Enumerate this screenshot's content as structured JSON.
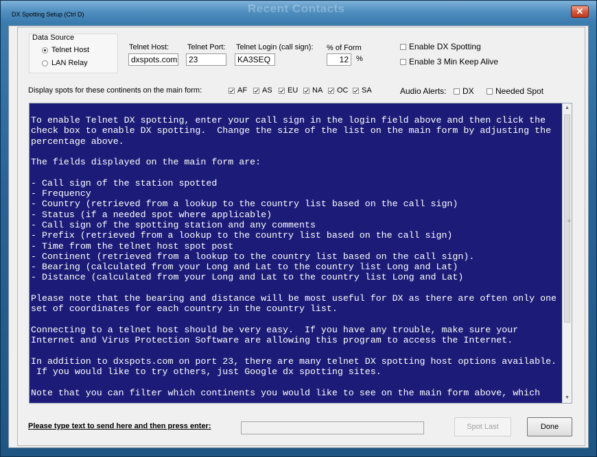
{
  "window": {
    "title": "DX Spotting Setup   (Ctrl D)",
    "background_title": "Recent Contacts",
    "close_glyph": "✕"
  },
  "data_source": {
    "title": "Data Source",
    "options": [
      {
        "label": "Telnet Host",
        "selected": true
      },
      {
        "label": "LAN Relay",
        "selected": false
      }
    ]
  },
  "telnet": {
    "host_label": "Telnet Host:",
    "host_value": "dxspots.com",
    "port_label": "Telnet Port:",
    "port_value": "23",
    "login_label": "Telnet Login (call sign):",
    "login_value": "KA3SEQ"
  },
  "form_percent": {
    "label": "% of Form",
    "value": "12",
    "unit": "%"
  },
  "options": {
    "enable_dx_spotting": {
      "label": "Enable DX Spotting",
      "checked": false
    },
    "keep_alive": {
      "label": "Enable 3 Min Keep Alive",
      "checked": false
    }
  },
  "continents": {
    "label": "Display spots for these continents on the main form:",
    "items": [
      {
        "code": "AF",
        "checked": true
      },
      {
        "code": "AS",
        "checked": true
      },
      {
        "code": "EU",
        "checked": true
      },
      {
        "code": "NA",
        "checked": true
      },
      {
        "code": "OC",
        "checked": true
      },
      {
        "code": "SA",
        "checked": true
      }
    ]
  },
  "audio_alerts": {
    "label": "Audio Alerts:",
    "dx": {
      "label": "DX",
      "checked": false
    },
    "needed": {
      "label": "Needed Spot",
      "checked": false
    }
  },
  "info_text": "To enable Telnet DX spotting, enter your call sign in the login field above and then click the\ncheck box to enable DX spotting.  Change the size of the list on the main form by adjusting the\npercentage above.\n\nThe fields displayed on the main form are:\n\n- Call sign of the station spotted\n- Frequency\n- Country (retrieved from a lookup to the country list based on the call sign)\n- Status (if a needed spot where applicable)\n- Call sign of the spotting station and any comments\n- Prefix (retrieved from a lookup to the country list based on the call sign)\n- Time from the telnet host spot post\n- Continent (retrieved from a lookup to the country list based on the call sign).\n- Bearing (calculated from your Long and Lat to the country list Long and Lat)\n- Distance (calculated from your Long and Lat to the country list Long and Lat)\n\nPlease note that the bearing and distance will be most useful for DX as there are often only one\nset of coordinates for each country in the country list.\n\nConnecting to a telnet host should be very easy.  If you have any trouble, make sure your\nInternet and Virus Protection Software are allowing this program to access the Internet.\n\nIn addition to dxspots.com on port 23, there are many telnet DX spotting host options available.\n If you would like to try others, just Google dx spotting sites.\n\nNote that you can filter which continents you would like to see on the main form above, which",
  "bottom": {
    "send_label": "Please type text to send here and then press enter:",
    "send_value": "",
    "spot_last_label": "Spot Last",
    "done_label": "Done"
  },
  "colors": {
    "info_background": "#1c1c78",
    "info_text": "#ffffff",
    "frame": "#2a6496"
  }
}
